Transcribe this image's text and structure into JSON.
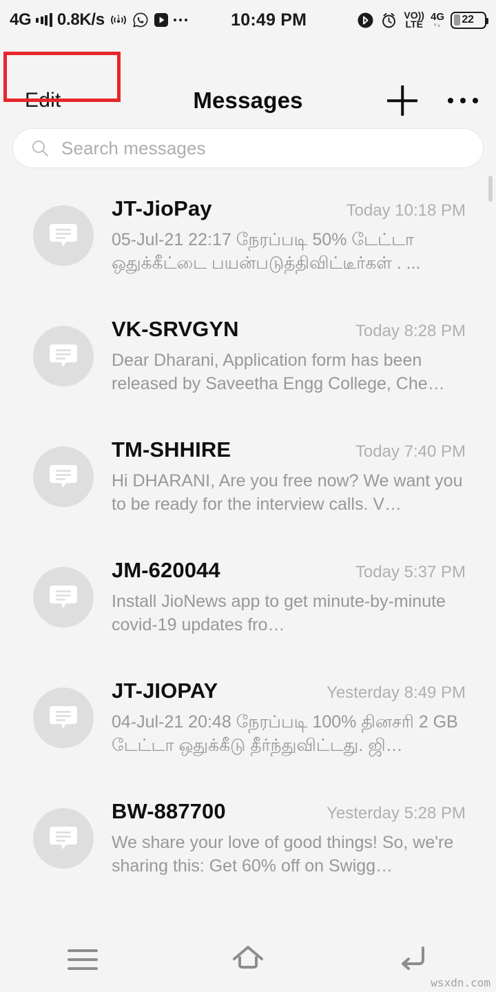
{
  "status_bar": {
    "network_type": "4G",
    "data_speed": "0.8K/s",
    "signal_icon": "signal-bars-icon",
    "hotspot_icon": "hotspot-icon",
    "whatsapp_icon": "whatsapp-icon",
    "youtube_icon": "youtube-icon",
    "more_icon": "more-notifications-icon",
    "clock": "10:49 PM",
    "bluetooth_icon": "bluetooth-icon",
    "alarm_icon": "alarm-icon",
    "volte_line1": "VO))",
    "volte_line2": "LTE",
    "sim_network": "4G",
    "data_arrows": "▾▴",
    "battery_percent": "22",
    "battery_level": 22
  },
  "header": {
    "edit_label": "Edit",
    "title": "Messages",
    "add_icon": "plus-icon",
    "overflow_icon": "overflow-menu-icon",
    "highlight_color": "#e8252a"
  },
  "search": {
    "icon": "search-icon",
    "placeholder": "Search messages",
    "value": ""
  },
  "messages": [
    {
      "avatar_icon": "message-bubble-icon",
      "sender": "JT-JioPay",
      "time": "Today 10:18 PM",
      "preview": "05-Jul-21 22:17 நேரப்படி 50% டேட்டா ஒதுக்கீட்டை பயன்படுத்திவிட்டீர்கள் . ..."
    },
    {
      "avatar_icon": "message-bubble-icon",
      "sender": "VK-SRVGYN",
      "time": "Today 8:28 PM",
      "preview": "Dear Dharani, Application form has been released by Saveetha Engg College, Che…"
    },
    {
      "avatar_icon": "message-bubble-icon",
      "sender": "TM-SHHIRE",
      "time": "Today 7:40 PM",
      "preview": "Hi DHARANI, Are you free now? We want you to be ready for the interview calls. V…"
    },
    {
      "avatar_icon": "message-bubble-icon",
      "sender": "JM-620044",
      "time": "Today 5:37 PM",
      "preview": "Install JioNews app to get minute-by-minute covid-19 updates fro…"
    },
    {
      "avatar_icon": "message-bubble-icon",
      "sender": "JT-JIOPAY",
      "time": "Yesterday 8:49 PM",
      "preview": "04-Jul-21 20:48 நேரப்படி 100% தினசரி 2 GB டேட்டா ஒதுக்கீடு தீர்ந்துவிட்டது. ஜி…"
    },
    {
      "avatar_icon": "message-bubble-icon",
      "sender": "BW-887700",
      "time": "Yesterday 5:28 PM",
      "preview": "We share your love of good things! So, we're sharing this: Get 60% off on Swigg…"
    }
  ],
  "nav_bar": {
    "menu_icon": "recent-apps-icon",
    "home_icon": "home-icon",
    "back_icon": "back-icon"
  },
  "watermark": "wsxdn.com"
}
